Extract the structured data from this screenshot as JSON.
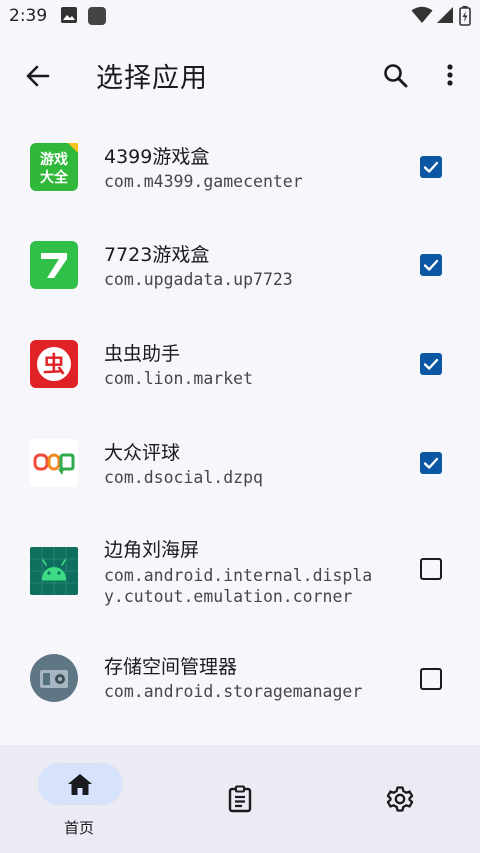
{
  "status_bar": {
    "time": "2:39",
    "icons": [
      "image-icon",
      "app-square-icon",
      "wifi-icon",
      "signal-icon",
      "battery-icon"
    ]
  },
  "app_bar": {
    "title": "选择应用",
    "back_icon": "arrow-back-icon",
    "actions": [
      "search-icon",
      "more-vert-icon"
    ]
  },
  "apps": [
    {
      "name": "4399游戏盒",
      "package": "com.m4399.gamecenter",
      "checked": true,
      "icon": "4399-icon"
    },
    {
      "name": "7723游戏盒",
      "package": "com.upgadata.up7723",
      "checked": true,
      "icon": "7723-icon"
    },
    {
      "name": "虫虫助手",
      "package": "com.lion.market",
      "checked": true,
      "icon": "chongchong-icon"
    },
    {
      "name": "大众评球",
      "package": "com.dsocial.dzpq",
      "checked": true,
      "icon": "dazhong-icon"
    },
    {
      "name": "边角刘海屏",
      "package_lines": [
        "com.android.internal.displa",
        "y.cutout.emulation.corner"
      ],
      "checked": false,
      "icon": "android-icon"
    },
    {
      "name": "存储空间管理器",
      "package": "com.android.storagemanager",
      "checked": false,
      "icon": "storage-manager-icon"
    }
  ],
  "icon_text": {
    "4399": [
      "游戏",
      "大全"
    ],
    "chongchong": "虫"
  },
  "bottom_nav": {
    "items": [
      {
        "label": "首页",
        "icon": "home-icon",
        "selected": true
      },
      {
        "label": "",
        "icon": "log-icon",
        "selected": false
      },
      {
        "label": "",
        "icon": "settings-icon",
        "selected": false
      }
    ]
  },
  "colors": {
    "accent": "#0b57a4",
    "background": "#f6f6fb",
    "nav_background": "#ecebf3",
    "nav_pill": "#d6e3fb"
  }
}
